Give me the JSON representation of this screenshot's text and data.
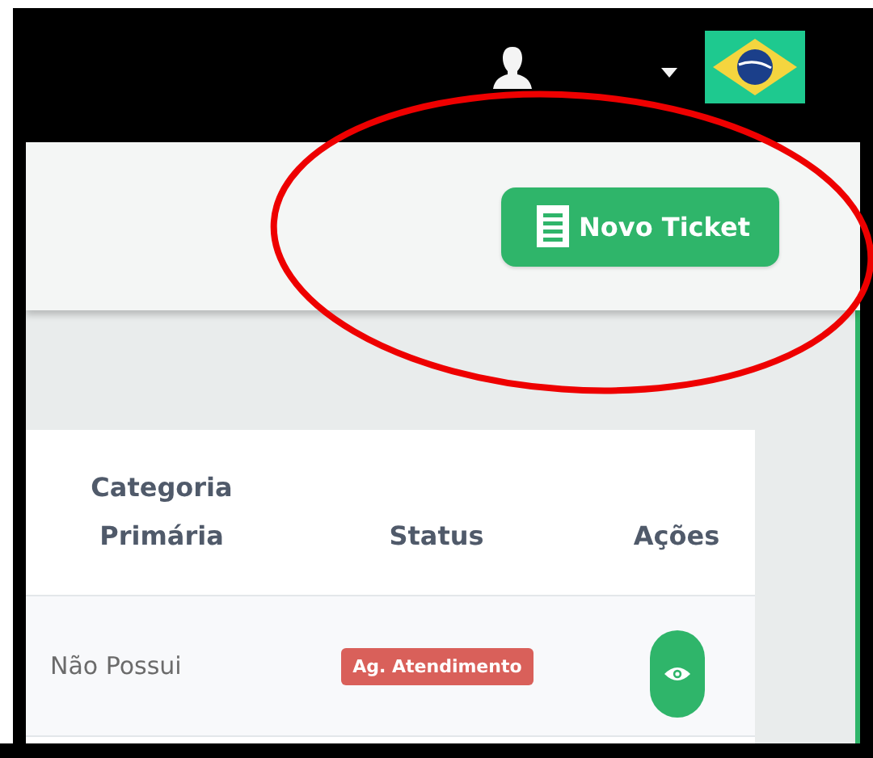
{
  "header": {
    "button": "Novo Ticket"
  },
  "table": {
    "columns": [
      "Categoria Primária",
      "Status",
      "Ações"
    ],
    "rows": [
      {
        "category": "Não Possui",
        "status": "Ag. Atendimento"
      }
    ]
  }
}
